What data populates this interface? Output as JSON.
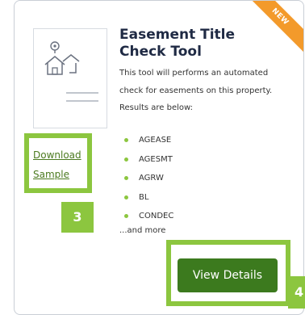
{
  "card": {
    "badge": "NEW",
    "title": "Easement Title Check Tool",
    "description": "This tool will performs an automated check for easements on this property. Results are below:",
    "codes": [
      "AGEASE",
      "AGESMT",
      "AGRW",
      "BL",
      "CONDEC"
    ],
    "more_text": "...and more",
    "download_label": "Download Sample",
    "view_details_label": "View Details"
  },
  "callouts": {
    "download": "3",
    "view_details": "4"
  },
  "colors": {
    "accent_green": "#8cc63f",
    "button_green": "#3c7a1e",
    "badge_orange": "#f39a2b",
    "title_navy": "#1f2a44"
  },
  "icons": {
    "thumbnail": "house-location-icon"
  }
}
